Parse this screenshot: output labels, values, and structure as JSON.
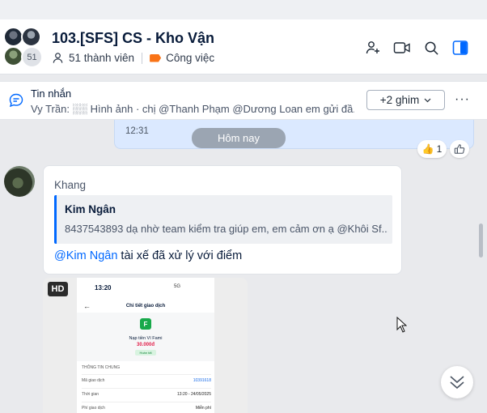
{
  "header": {
    "title": "103.[SFS] CS - Kho Vận",
    "member_count_badge": "51",
    "members_label": "51 thành viên",
    "category_label": "Công việc",
    "icons": [
      "add-member-icon",
      "video-call-icon",
      "search-icon",
      "sidebar-toggle-icon"
    ]
  },
  "pinned": {
    "title": "Tin nhắn",
    "snippet": "Vy Trần: ░░ Hình ảnh · chị @Thanh Phạm @Dương Loan em gửi đầ...",
    "button_label": "+2 ghim",
    "more_label": "···"
  },
  "own_message": {
    "time": "12:31"
  },
  "date_divider": "Hôm nay",
  "reactions": {
    "like_count": "1"
  },
  "message": {
    "sender": "Khang",
    "quote_name": "Kim Ngân",
    "quote_text": "8437543893 dạ nhờ team kiểm tra giúp em, em cảm ơn ạ @Khôi Sf...",
    "mention": "@Kim Ngân",
    "text": " tài xế đã xử lý với điểm"
  },
  "image_message": {
    "badge": "HD",
    "phone_time": "13:20",
    "phone_status": "5G",
    "screen_title": "Chi tiết giao dịch",
    "logo_letter": "F",
    "product": "Nạp tiền Ví Fami",
    "amount": "30.000đ",
    "status": "Hoàn tất",
    "section": "THÔNG TIN CHUNG",
    "rows": [
      {
        "label": "Mã giao dịch",
        "value": "10391618"
      },
      {
        "label": "Thời gian",
        "value": "13:20 - 24/05/2025"
      },
      {
        "label": "Phí giao dịch",
        "value": "Miễn phí"
      }
    ]
  },
  "colors": {
    "accent": "#0068ff",
    "own_bubble": "#dbe9ff",
    "tag": "#f97316"
  }
}
